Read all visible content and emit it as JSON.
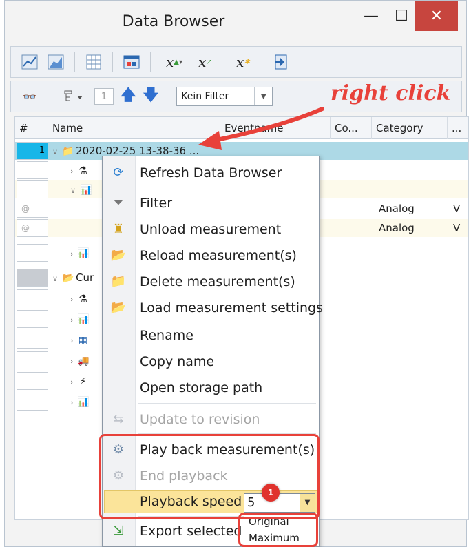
{
  "window": {
    "title": "Data Browser",
    "minimize": "—",
    "maximize": "☐",
    "close": "✕"
  },
  "toolbar2": {
    "page": "1",
    "filter_value": "Kein Filter"
  },
  "annotation": {
    "text": "right click",
    "color": "#e8413a",
    "badge": "1"
  },
  "grid": {
    "columns": [
      "#",
      "Name",
      "Eventname",
      "Co...",
      "Category",
      "..."
    ],
    "rows": [
      {
        "num": "1",
        "name": "2020-02-25 13-38-36 ...",
        "category": "",
        "unit": "",
        "selected": true
      },
      {
        "num": "",
        "name": "",
        "category": "",
        "unit": ""
      },
      {
        "num": "",
        "name": "",
        "category": "",
        "unit": ""
      },
      {
        "num": "@",
        "name": "",
        "category": "Analog",
        "unit": "V"
      },
      {
        "num": "@",
        "name": "",
        "category": "Analog",
        "unit": "V"
      },
      {
        "num": "",
        "name": "",
        "category": "",
        "unit": ""
      },
      {
        "num": "",
        "name": "Cur",
        "category": "",
        "unit": ""
      },
      {
        "num": "",
        "name": "",
        "category": "",
        "unit": ""
      },
      {
        "num": "",
        "name": "",
        "category": "",
        "unit": ""
      },
      {
        "num": "",
        "name": "",
        "category": "",
        "unit": ""
      },
      {
        "num": "",
        "name": "",
        "category": "",
        "unit": ""
      },
      {
        "num": "",
        "name": "",
        "category": "",
        "unit": ""
      },
      {
        "num": "",
        "name": "",
        "category": "",
        "unit": ""
      }
    ]
  },
  "context_menu": {
    "items": [
      {
        "label": "Refresh Data Browser",
        "icon": "refresh-icon",
        "disabled": false
      },
      {
        "label": "Filter",
        "icon": "funnel-icon",
        "disabled": false
      },
      {
        "label": "Unload measurement",
        "icon": "unload-icon",
        "disabled": false
      },
      {
        "label": "Reload measurement(s)",
        "icon": "reload-icon",
        "disabled": false
      },
      {
        "label": "Delete measurement(s)",
        "icon": "delete-folder-icon",
        "disabled": false
      },
      {
        "label": "Load measurement settings",
        "icon": "settings-folder-icon",
        "disabled": false
      },
      {
        "label": "Rename",
        "icon": "",
        "disabled": false
      },
      {
        "label": "Copy name",
        "icon": "",
        "disabled": false
      },
      {
        "label": "Open storage path",
        "icon": "",
        "disabled": false
      },
      {
        "label": "Update to revision",
        "icon": "revision-icon",
        "disabled": true
      },
      {
        "label": "Play back measurement(s)",
        "icon": "playback-icon",
        "disabled": false
      },
      {
        "label": "End playback",
        "icon": "end-playback-icon",
        "disabled": true
      },
      {
        "label": "Playback speed",
        "icon": "",
        "disabled": false
      },
      {
        "label": "Export selected",
        "icon": "export-icon",
        "disabled": false
      }
    ],
    "playback_speed_value": "5",
    "speed_options": [
      "Original",
      "Maximum"
    ]
  }
}
